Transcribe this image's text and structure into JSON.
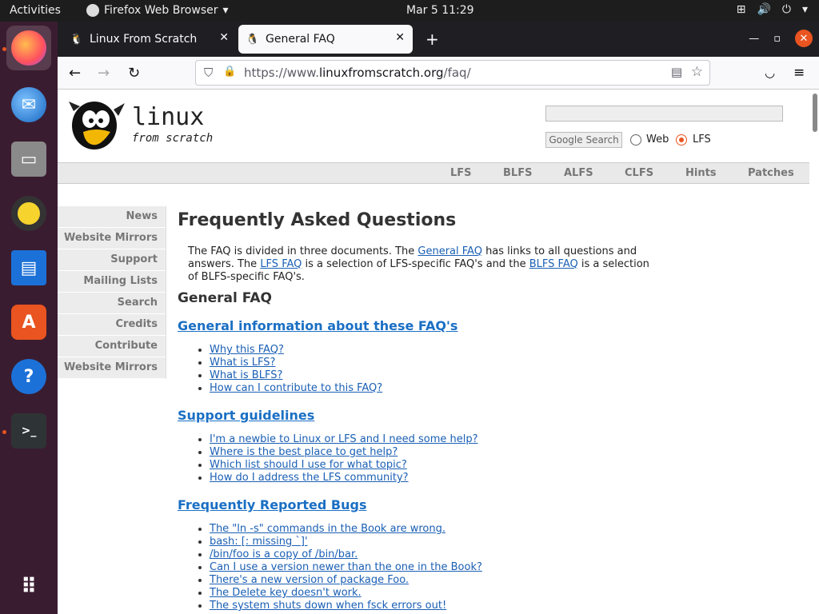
{
  "topbar": {
    "activities": "Activities",
    "app_name": "Firefox Web Browser",
    "clock": "Mar 5  11:29"
  },
  "tabs": [
    {
      "title": "Linux From Scratch"
    },
    {
      "title": "General FAQ"
    }
  ],
  "urlbar": {
    "prefix": "https://www.",
    "domain": "linuxfromscratch.org",
    "path": "/faq/"
  },
  "logo": {
    "line1": "linux",
    "line2": "from scratch"
  },
  "search": {
    "button": "Google Search",
    "options": [
      "Web",
      "LFS"
    ],
    "selected": "LFS"
  },
  "topnav": [
    "LFS",
    "BLFS",
    "ALFS",
    "CLFS",
    "Hints",
    "Patches"
  ],
  "sidebar": [
    "News",
    "Website Mirrors",
    "Support",
    "Mailing Lists",
    "Search",
    "Credits",
    "Contribute",
    "Website Mirrors"
  ],
  "content": {
    "title": "Frequently Asked Questions",
    "intro": {
      "t1": "The FAQ is divided in three documents. The ",
      "l1": "General FAQ",
      "t2": " has links to all questions and answers. The ",
      "l2": "LFS FAQ",
      "t3": " is a selection of LFS-specific FAQ's and the ",
      "l3": "BLFS FAQ",
      "t4": " is a selection of BLFS-specific FAQ's."
    },
    "subtitle": "General FAQ",
    "sections": [
      {
        "heading": "General information about these FAQ's",
        "items": [
          "Why this FAQ?",
          "What is LFS?",
          "What is BLFS?",
          "How can I contribute to this FAQ?"
        ]
      },
      {
        "heading": "Support guidelines",
        "items": [
          "I'm a newbie to Linux or LFS and I need some help?",
          "Where is the best place to get help?",
          "Which list should I use for what topic?",
          "How do I address the LFS community?"
        ]
      },
      {
        "heading": "Frequently Reported Bugs",
        "items": [
          "The \"ln -s\" commands in the Book are wrong.",
          "bash: [: missing `]'",
          "/bin/foo is a copy of /bin/bar.",
          "Can I use a version newer than the one in the Book?",
          "There's a new version of package Foo.",
          "The Delete key doesn't work.",
          "The system shuts down when fsck errors out!"
        ]
      }
    ]
  }
}
